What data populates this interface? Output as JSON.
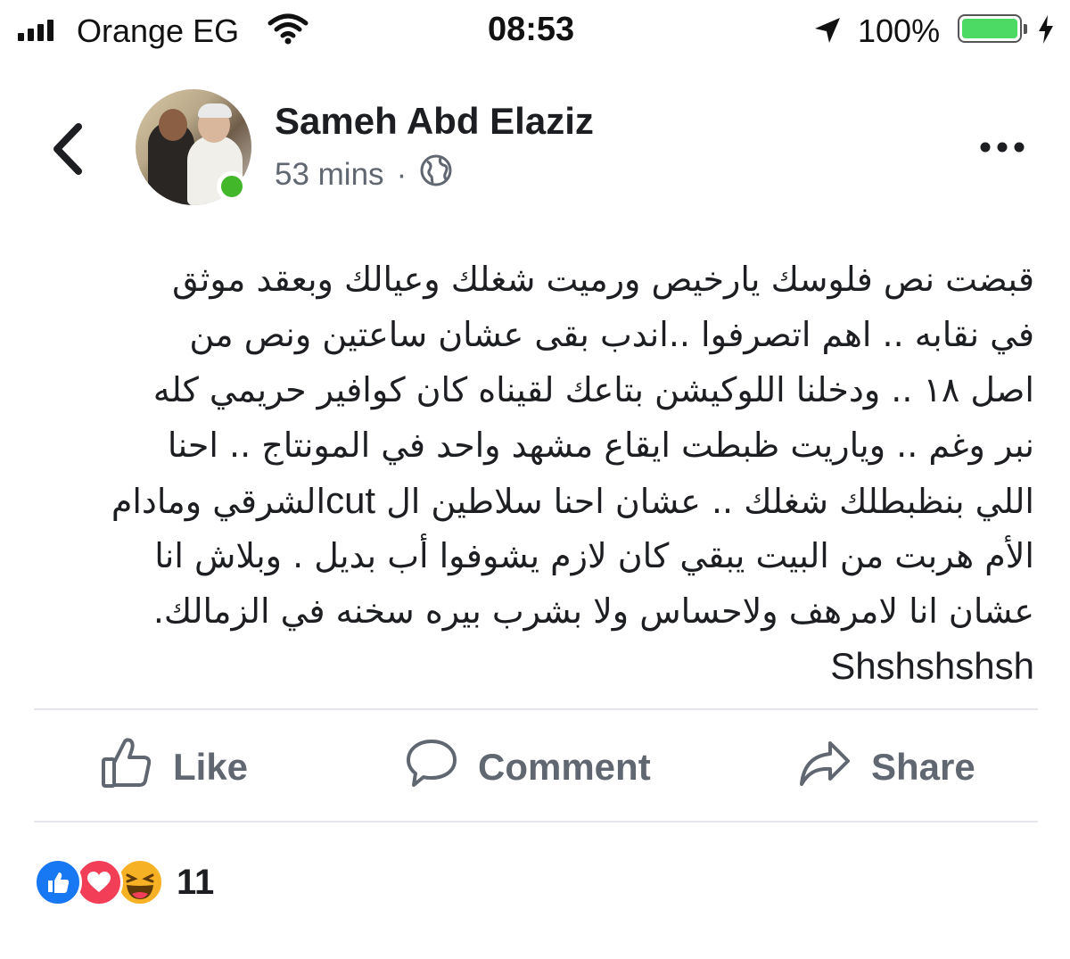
{
  "status_bar": {
    "carrier": "Orange EG",
    "time": "08:53",
    "battery_percent": "100%",
    "battery_level": 1.0,
    "icons": [
      "signal-icon",
      "wifi-icon",
      "location-arrow-icon",
      "battery-icon",
      "charging-icon"
    ],
    "battery_color": "#4cd964"
  },
  "post": {
    "author": "Sameh Abd Elaziz",
    "time": "53 mins",
    "separator": "·",
    "privacy_icon": "globe-icon",
    "online_color": "#42b72a",
    "lines": [
      "قبضت نص فلوسك يارخيص ورميت شغلك وعيالك وبعقد موثق",
      "في نقابه .. اهم اتصرفوا ..اندب بقى عشان ساعتين ونص من",
      "اصل ١٨ .. ودخلنا اللوكيشن بتاعك لقيناه كان كوافير حريمي كله",
      "نبر وغم .. وياريت ظبطت ايقاع مشهد واحد في المونتاج .. احنا",
      "اللي بنظبطلك شغلك .. عشان احنا سلاطين ال",
      "الأم هربت من البيت يبقي كان لازم يشوفوا أب بديل . وبلاش انا",
      "عشان انا لامرهف ولاحساس ولا بشرب بيره سخنه في الزمالك.",
      "Shshshshsh"
    ],
    "line5_latin": "cut",
    "line5_end": "الشرقي ومادام"
  },
  "actions": {
    "like": "Like",
    "comment": "Comment",
    "share": "Share",
    "text_color": "#606770"
  },
  "reactions": {
    "count": "11",
    "types": [
      "like-reaction-icon",
      "love-reaction-icon",
      "haha-reaction-icon"
    ]
  }
}
